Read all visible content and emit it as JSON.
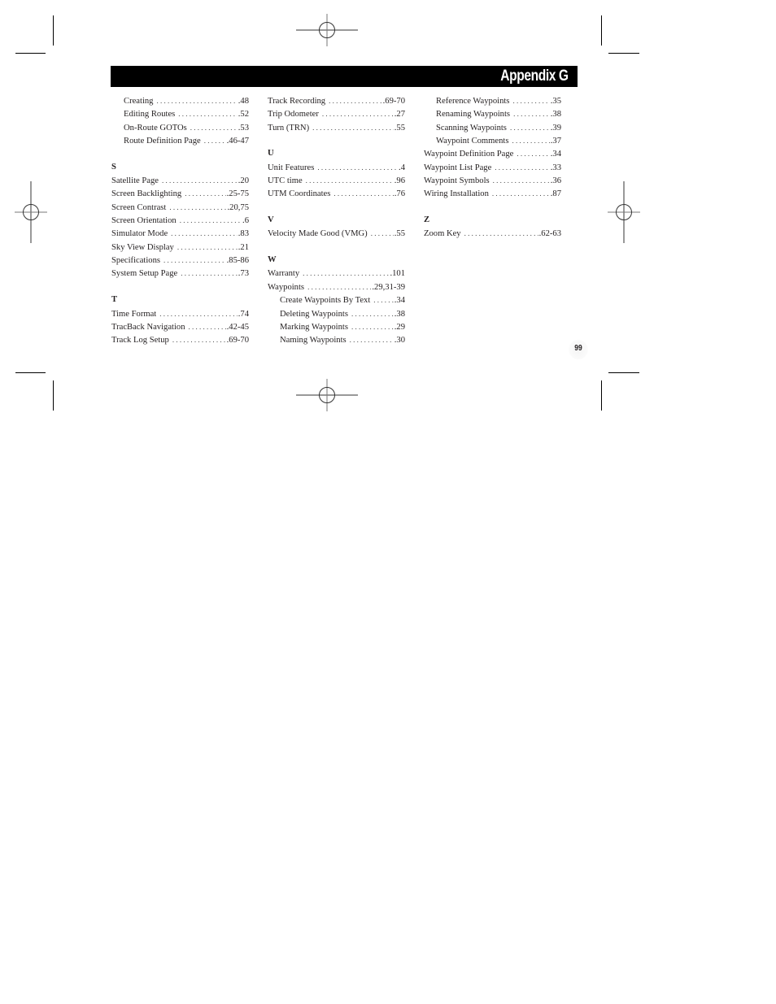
{
  "header": {
    "title": "Appendix G"
  },
  "page_number": "99",
  "columns": [
    {
      "entries": [
        {
          "type": "sub",
          "label": "Creating",
          "page": ".48"
        },
        {
          "type": "sub",
          "label": "Editing Routes",
          "page": ".52"
        },
        {
          "type": "sub",
          "label": "On-Route GOTOs",
          "page": ".53"
        },
        {
          "type": "sub",
          "label": "Route Definition Page",
          "page": ".46-47"
        },
        {
          "type": "gap"
        },
        {
          "type": "letter",
          "label": "S"
        },
        {
          "type": "main",
          "label": "Satellite Page",
          "page": ".20"
        },
        {
          "type": "main",
          "label": "Screen Backlighting",
          "page": ".25-75"
        },
        {
          "type": "main",
          "label": "Screen Contrast",
          "page": ".20,75"
        },
        {
          "type": "main",
          "label": "Screen Orientation",
          "page": ".6"
        },
        {
          "type": "main",
          "label": "Simulator Mode",
          "page": ".83"
        },
        {
          "type": "main",
          "label": "Sky View Display",
          "page": ".21"
        },
        {
          "type": "main",
          "label": "Specifications",
          "page": ".85-86"
        },
        {
          "type": "main",
          "label": "System Setup Page",
          "page": ".73"
        },
        {
          "type": "gap"
        },
        {
          "type": "letter",
          "label": "T"
        },
        {
          "type": "main",
          "label": "Time Format",
          "page": ".74"
        },
        {
          "type": "main",
          "label": "TracBack Navigation",
          "page": ".42-45"
        },
        {
          "type": "main",
          "label": "Track Log Setup",
          "page": ".69-70"
        }
      ]
    },
    {
      "entries": [
        {
          "type": "main",
          "label": "Track Recording",
          "page": ".69-70"
        },
        {
          "type": "main",
          "label": "Trip Odometer",
          "page": ".27"
        },
        {
          "type": "main",
          "label": "Turn (TRN)",
          "page": ".55"
        },
        {
          "type": "gap"
        },
        {
          "type": "letter",
          "label": "U"
        },
        {
          "type": "main",
          "label": "Unit Features",
          "page": ".4"
        },
        {
          "type": "main",
          "label": "UTC time",
          "page": ".96"
        },
        {
          "type": "main",
          "label": "UTM Coordinates",
          "page": ".76"
        },
        {
          "type": "gap"
        },
        {
          "type": "letter",
          "label": "V"
        },
        {
          "type": "main",
          "label": "Velocity Made Good (VMG)",
          "page": ".55"
        },
        {
          "type": "gap"
        },
        {
          "type": "letter",
          "label": "W"
        },
        {
          "type": "main",
          "label": "Warranty",
          "page": ".101"
        },
        {
          "type": "main",
          "label": "Waypoints",
          "page": ".29,31-39"
        },
        {
          "type": "sub",
          "label": "Create Waypoints By Text",
          "page": ".34"
        },
        {
          "type": "sub",
          "label": "Deleting Waypoints",
          "page": ".38"
        },
        {
          "type": "sub",
          "label": "Marking Waypoints",
          "page": ".29"
        },
        {
          "type": "sub",
          "label": "Naming Waypoints",
          "page": ".30"
        }
      ]
    },
    {
      "entries": [
        {
          "type": "sub",
          "label": "Reference Waypoints",
          "page": ".35"
        },
        {
          "type": "sub",
          "label": "Renaming Waypoints",
          "page": ".38"
        },
        {
          "type": "sub",
          "label": "Scanning Waypoints",
          "page": ".39"
        },
        {
          "type": "sub",
          "label": "Waypoint Comments",
          "page": ".37"
        },
        {
          "type": "main",
          "label": "Waypoint Definition Page",
          "page": ".34"
        },
        {
          "type": "main",
          "label": "Waypoint List Page",
          "page": ".33"
        },
        {
          "type": "main",
          "label": "Waypoint Symbols",
          "page": ".36"
        },
        {
          "type": "main",
          "label": "Wiring Installation",
          "page": ".87"
        },
        {
          "type": "gap"
        },
        {
          "type": "letter",
          "label": "Z"
        },
        {
          "type": "main",
          "label": "Zoom Key",
          "page": ".62-63"
        }
      ]
    }
  ]
}
